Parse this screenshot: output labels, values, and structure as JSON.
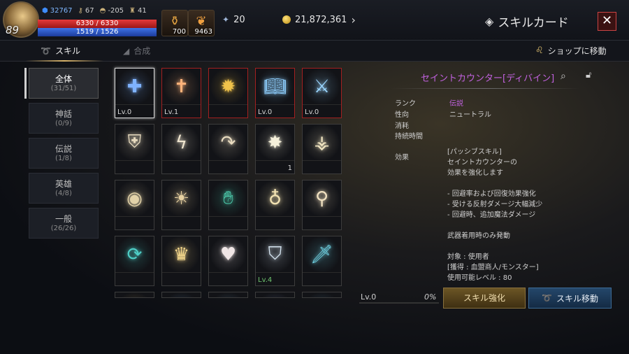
{
  "player": {
    "level": "89",
    "stat_a": "32767",
    "stat_b": "67",
    "stat_c": "-205",
    "stat_d": "41",
    "hp": "6330 / 6330",
    "mp": "1519 / 1526"
  },
  "items": [
    {
      "qty": "700",
      "icon": "potion-icon"
    },
    {
      "qty": "9463",
      "icon": "feather-icon"
    }
  ],
  "currency": {
    "tickets": "20",
    "gold": "21,872,361"
  },
  "header": {
    "title": "スキルカード"
  },
  "tabs": [
    {
      "label": "スキル",
      "active": true
    },
    {
      "label": "合成",
      "active": false
    }
  ],
  "shop_label": "ショップに移動",
  "categories": [
    {
      "name": "全体",
      "count": "(31/51)"
    },
    {
      "name": "神話",
      "count": "(0/9)"
    },
    {
      "name": "伝説",
      "count": "(1/8)"
    },
    {
      "name": "英雄",
      "count": "(4/8)"
    },
    {
      "name": "一般",
      "count": "(26/26)"
    }
  ],
  "cards": [
    {
      "icon": "cross-shield-icon",
      "lv": "Lv.0",
      "num": "",
      "color": "#7fb3ff"
    },
    {
      "icon": "cross-burst-icon",
      "lv": "Lv.1",
      "num": "",
      "color": "#ffb37a"
    },
    {
      "icon": "sun-shield-icon",
      "lv": "",
      "num": "",
      "color": "#f0c24a"
    },
    {
      "icon": "holy-book-icon",
      "lv": "Lv.0",
      "num": "",
      "color": "#8fd0ff"
    },
    {
      "icon": "blade-strike-icon",
      "lv": "Lv.0",
      "num": "",
      "color": "#9ad6ff"
    },
    {
      "icon": "shield-icon",
      "lv": "",
      "num": "",
      "color": "#e9dcc0"
    },
    {
      "icon": "lightning-icon",
      "lv": "",
      "num": "",
      "color": "#f0e6d0"
    },
    {
      "icon": "curved-arrow-icon",
      "lv": "",
      "num": "",
      "color": "#e9dcc0"
    },
    {
      "icon": "starburst-icon",
      "lv": "",
      "num": "1",
      "color": "#f5f0da"
    },
    {
      "icon": "altar-icon",
      "lv": "",
      "num": "",
      "color": "#f2e6c2"
    },
    {
      "icon": "eye-icon",
      "lv": "",
      "num": "",
      "color": "#e2d2a8"
    },
    {
      "icon": "sun-face-icon",
      "lv": "",
      "num": "",
      "color": "#e6d0a0"
    },
    {
      "icon": "slashed-hand-icon",
      "lv": "",
      "num": "",
      "color": "#4fd0b0"
    },
    {
      "icon": "orb-pedestal-icon",
      "lv": "",
      "num": "",
      "color": "#f2e2b2"
    },
    {
      "icon": "mace-icon",
      "lv": "",
      "num": "",
      "color": "#f0e0c0"
    },
    {
      "icon": "cycle-icon",
      "lv": "",
      "num": "",
      "color": "#4fd0c8"
    },
    {
      "icon": "crown-flames-icon",
      "lv": "",
      "num": "",
      "color": "#f0d48a"
    },
    {
      "icon": "heart-icon",
      "lv": "",
      "num": "",
      "color": "#f0e6e6"
    },
    {
      "icon": "helm-emblem-icon",
      "lv": "Lv.4",
      "num": "",
      "color": "#d8e6f2"
    },
    {
      "icon": "sword-icon",
      "lv": "",
      "num": "",
      "color": "#6fd0e0"
    },
    {
      "icon": "flare-icon",
      "lv": "",
      "num": "",
      "color": "#ffd070"
    },
    {
      "icon": "sun-blue-icon",
      "lv": "",
      "num": "",
      "color": "#7fc0ff"
    },
    {
      "icon": "ring-icon",
      "lv": "",
      "num": "",
      "color": "#8fd0ff"
    },
    {
      "icon": "shield-cross-icon",
      "lv": "",
      "num": "",
      "color": "#9fb8ff"
    },
    {
      "icon": "compass-icon",
      "lv": "",
      "num": "",
      "color": "#6fc0e8"
    }
  ],
  "detail": {
    "title": "セイントカウンター[ディバイン]",
    "rank_label": "ランク",
    "rank_value": "伝説",
    "tendency_label": "性向",
    "tendency_value": "ニュートラル",
    "cost_label": "消耗",
    "duration_label": "持続時間",
    "effect_label": "効果",
    "effect_text": "[パッシブスキル]\nセイントカウンターの\n効果を強化します\n\n-  回避率および回復効果強化\n-  受ける反射ダメージ大幅減少\n-  回避時、追加魔法ダメージ\n\n武器着用時のみ発動\n\n対象 : 使用者\n[獲得 : 血盟商人/モンスター]\n使用可能レベル : 80"
  },
  "footer": {
    "level": "Lv.0",
    "percent": "0%",
    "upgrade_label": "スキル強化",
    "move_label": "スキル移動"
  }
}
